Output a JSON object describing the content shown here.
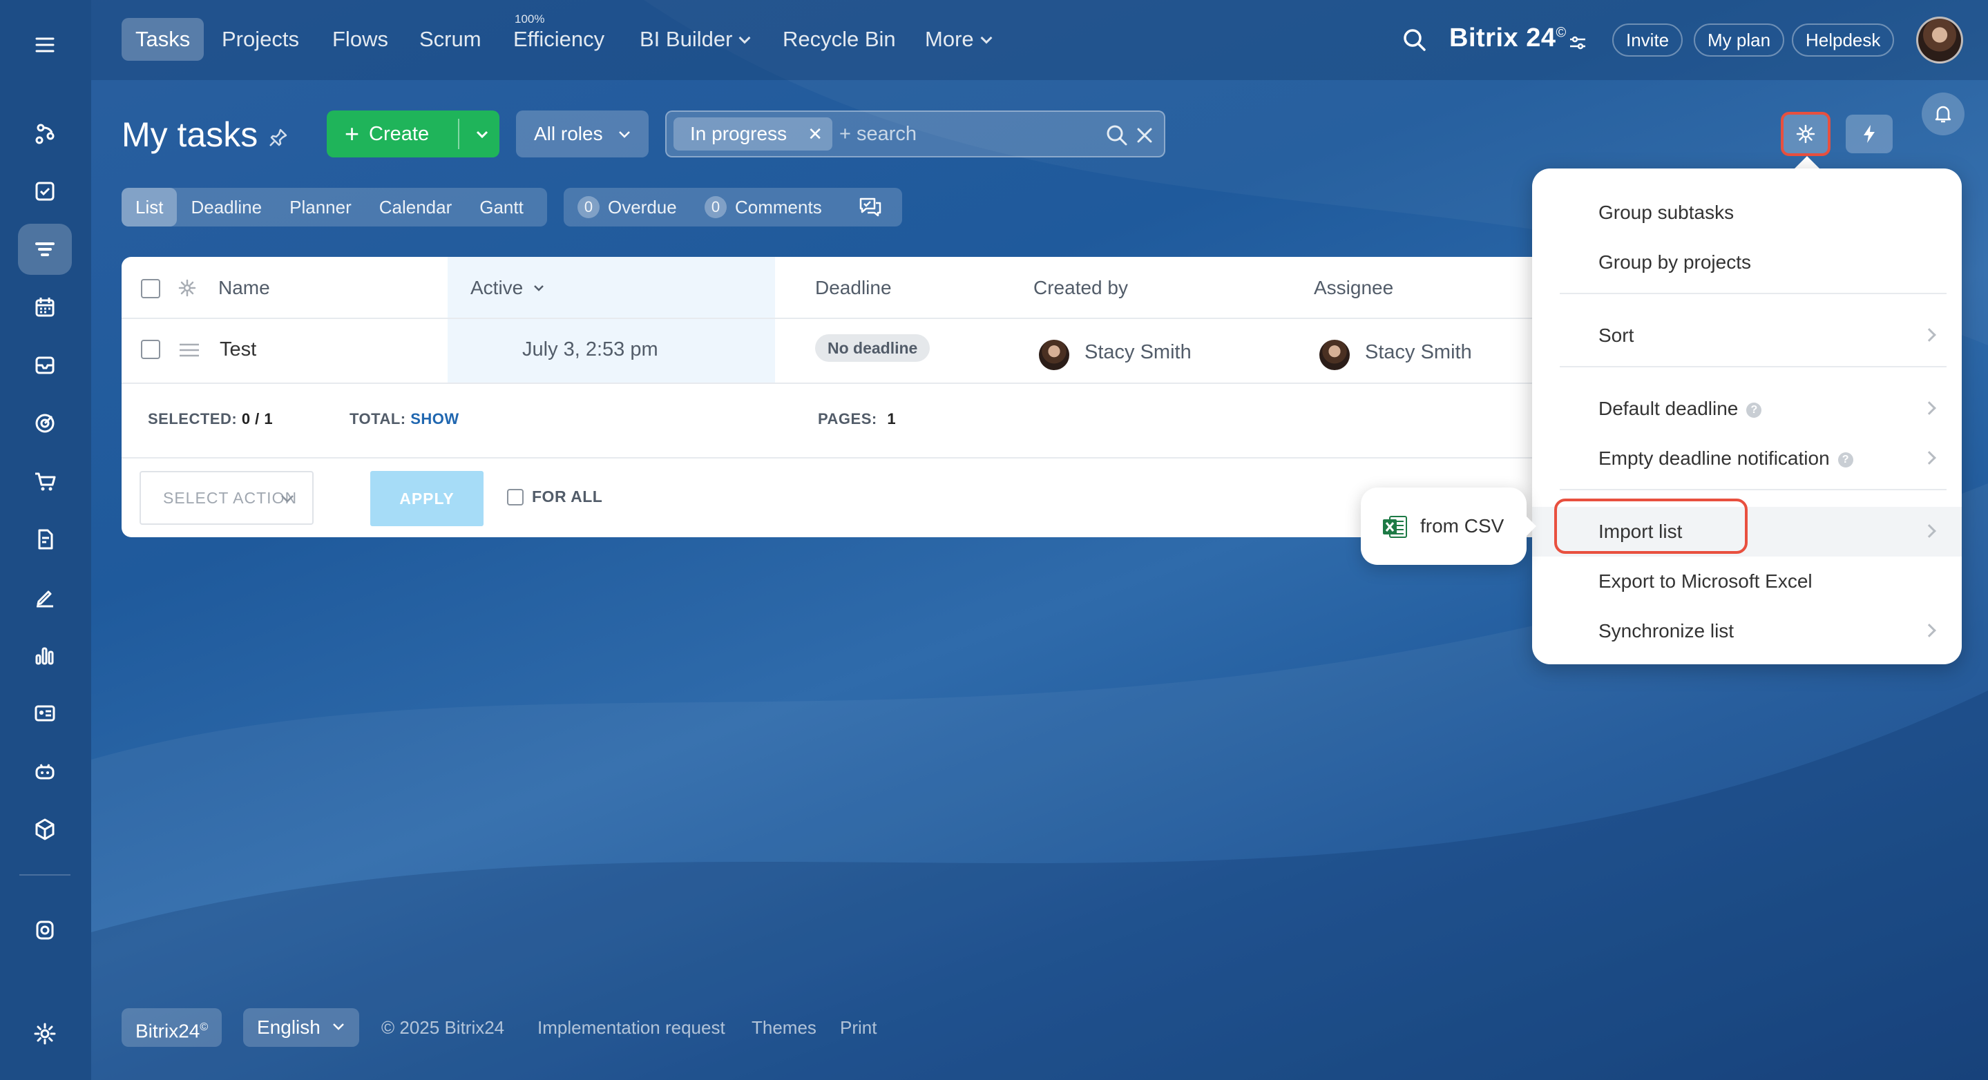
{
  "topnav": {
    "items": [
      "Tasks",
      "Projects",
      "Flows",
      "Scrum",
      "Efficiency",
      "BI Builder",
      "Recycle Bin",
      "More"
    ],
    "efficiency_badge": "100%",
    "brand": "Bitrix 24",
    "brand_mark": "©",
    "invite": "Invite",
    "my_plan": "My plan",
    "helpdesk": "Helpdesk"
  },
  "page": {
    "title": "My tasks",
    "create_label": "Create",
    "roles_label": "All roles",
    "filter_chip": "In progress",
    "search_placeholder": "+ search"
  },
  "views": [
    "List",
    "Deadline",
    "Planner",
    "Calendar",
    "Gantt"
  ],
  "counters": {
    "overdue_count": "0",
    "overdue_label": "Overdue",
    "comments_count": "0",
    "comments_label": "Comments"
  },
  "table": {
    "headers": {
      "name": "Name",
      "active": "Active",
      "deadline": "Deadline",
      "created_by": "Created by",
      "assignee": "Assignee"
    },
    "rows": [
      {
        "name": "Test",
        "active": "July 3, 2:53 pm",
        "deadline": "No deadline",
        "created_by": "Stacy Smith",
        "assignee": "Stacy Smith"
      }
    ],
    "footer": {
      "selected_label": "SELECTED:",
      "selected_value": "0 / 1",
      "total_label": "TOTAL:",
      "total_link": "SHOW",
      "pages_label": "PAGES:",
      "pages_value": "1"
    },
    "select_action": "SELECT ACTION",
    "apply": "APPLY",
    "for_all": "FOR ALL"
  },
  "menu": {
    "items": [
      "Group subtasks",
      "Group by projects",
      "Sort",
      "Default deadline",
      "Empty deadline notification",
      "Import list",
      "Export to Microsoft Excel",
      "Synchronize list"
    ],
    "help_glyph": "?"
  },
  "submenu": {
    "from_csv": "from CSV"
  },
  "footer": {
    "brand": "Bitrix24",
    "brand_mark": "©",
    "language": "English",
    "copyright": "© 2025 Bitrix24",
    "links": [
      "Implementation request",
      "Themes",
      "Print"
    ]
  },
  "colors": {
    "accent": "#1fb45a",
    "highlight_ring": "#e8503f",
    "link": "#2067b0"
  }
}
